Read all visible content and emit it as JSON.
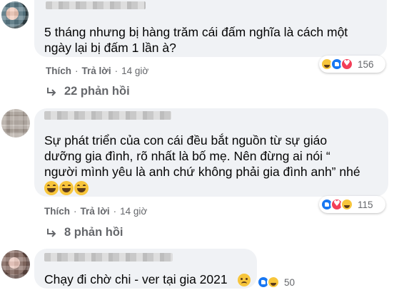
{
  "comments": [
    {
      "text": "5 tháng nhưng bị hàng trăm cái đấm nghĩa là cách một",
      "text_line2": "ngày lại bị đấm 1 lần à?",
      "like_label": "Thích",
      "reply_label": "Trả lời",
      "time": "14 giờ",
      "reaction_icons": [
        "haha-icon",
        "like-icon",
        "love-icon"
      ],
      "reaction_count": "156",
      "replies_label": "22 phản hồi"
    },
    {
      "text": "Sự phát triển của con cái đều bắt nguồn từ sự giáo",
      "text_line2": "dưỡng gia đình, rõ nhất là bố mẹ. Nên đừng ai nói “",
      "text_line3": "người mình yêu là anh chứ không phải gia đình anh” nhé",
      "emojis": [
        "laugh-icon",
        "laugh-icon",
        "laugh-icon"
      ],
      "like_label": "Thích",
      "reply_label": "Trả lời",
      "time": "14 giờ",
      "reaction_icons": [
        "like-icon",
        "love-icon",
        "haha-icon"
      ],
      "reaction_count": "115",
      "replies_label": "8 phản hồi"
    },
    {
      "text": "Chạy đi chờ chi - ver tại gia 2021",
      "emoji": "sad-face-icon",
      "reaction_icons": [
        "like-icon",
        "haha-icon"
      ],
      "reaction_count": "50"
    }
  ],
  "colors": {
    "bubble": "#f0f2f5",
    "meta_text": "#65676b",
    "like_blue": "#1877f2",
    "love_red": "#f33e58",
    "haha_yellow": "#f7c53b"
  }
}
